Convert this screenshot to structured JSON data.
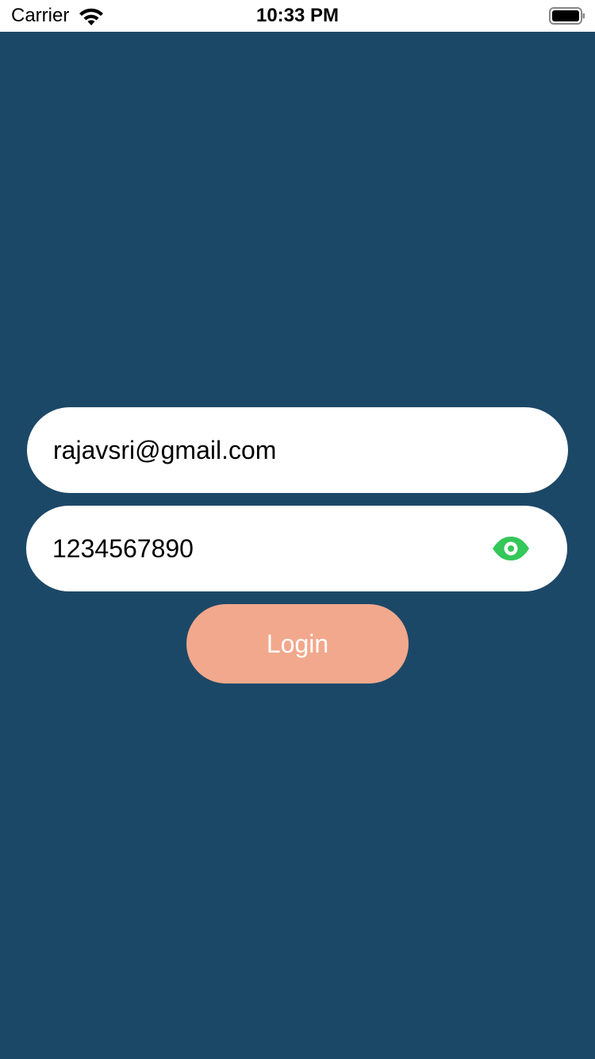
{
  "status_bar": {
    "carrier": "Carrier",
    "time": "10:33 PM",
    "icons": [
      "wifi-icon",
      "battery-icon"
    ]
  },
  "login_form": {
    "email_value": "rajavsri@gmail.com",
    "password_value": "1234567890",
    "password_toggle_icon": "eye-icon",
    "login_label": "Login"
  },
  "colors": {
    "background": "#1c4867",
    "field_background": "#ffffff",
    "button_background": "#f2a88c",
    "button_text": "#ffffff",
    "eye_icon": "#34c759"
  }
}
